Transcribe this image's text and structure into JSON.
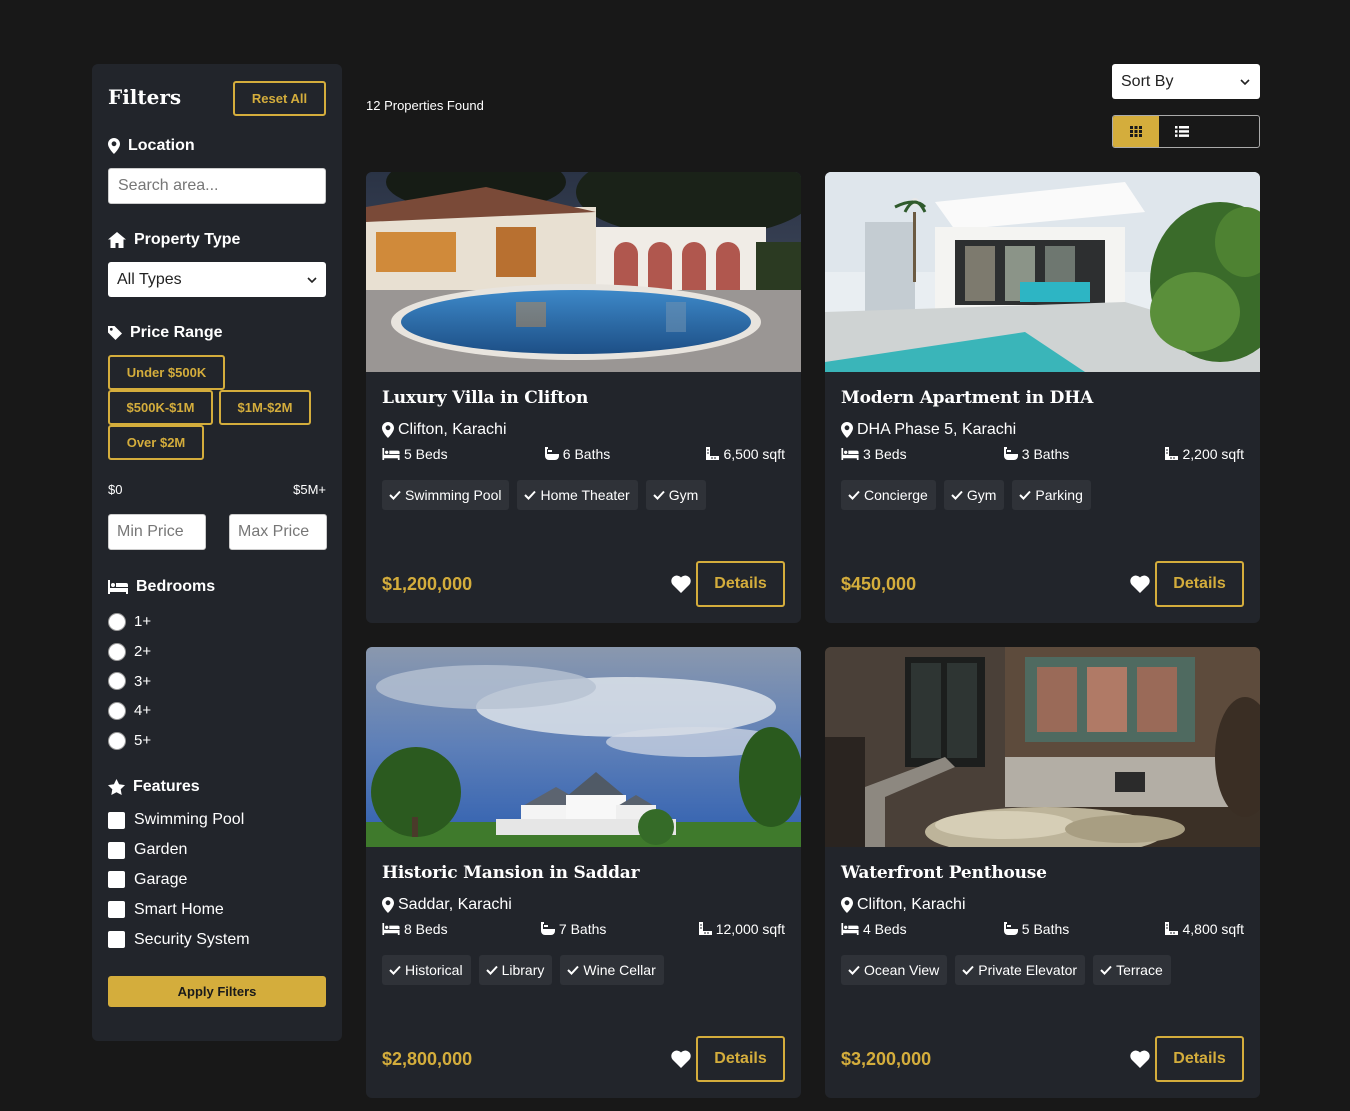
{
  "filters": {
    "title": "Filters",
    "reset_label": "Reset All",
    "location": {
      "label": "Location",
      "placeholder": "Search area..."
    },
    "property_type": {
      "label": "Property Type",
      "selected": "All Types"
    },
    "price_range": {
      "label": "Price Range",
      "chips": [
        "Under $500K",
        "$500K-$1M",
        "$1M-$2M",
        "Over $2M"
      ],
      "min_label": "$0",
      "max_label": "$5M+",
      "min_placeholder": "Min Price",
      "max_placeholder": "Max Price"
    },
    "bedrooms": {
      "label": "Bedrooms",
      "options": [
        "1+",
        "2+",
        "3+",
        "4+",
        "5+"
      ]
    },
    "features": {
      "label": "Features",
      "options": [
        "Swimming Pool",
        "Garden",
        "Garage",
        "Smart Home",
        "Security System"
      ]
    },
    "apply_label": "Apply Filters"
  },
  "results": {
    "count_text": "12 Properties Found"
  },
  "sort": {
    "label": "Sort By"
  },
  "colors": {
    "accent": "#d4ad3c",
    "background": "#181818",
    "card": "#22252b",
    "tag": "#2f3238"
  },
  "properties": [
    {
      "title": "Luxury Villa in Clifton",
      "location": "Clifton, Karachi",
      "beds": "5 Beds",
      "baths": "6 Baths",
      "area": "6,500 sqft",
      "tags": [
        "Swimming Pool",
        "Home Theater",
        "Gym"
      ],
      "price": "$1,200,000",
      "details_label": "Details"
    },
    {
      "title": "Modern Apartment in DHA",
      "location": "DHA Phase 5, Karachi",
      "beds": "3 Beds",
      "baths": "3 Baths",
      "area": "2,200 sqft",
      "tags": [
        "Concierge",
        "Gym",
        "Parking"
      ],
      "price": "$450,000",
      "details_label": "Details"
    },
    {
      "title": "Historic Mansion in Saddar",
      "location": "Saddar, Karachi",
      "beds": "8 Beds",
      "baths": "7 Baths",
      "area": "12,000 sqft",
      "tags": [
        "Historical",
        "Library",
        "Wine Cellar"
      ],
      "price": "$2,800,000",
      "details_label": "Details"
    },
    {
      "title": "Waterfront Penthouse",
      "location": "Clifton, Karachi",
      "beds": "4 Beds",
      "baths": "5 Baths",
      "area": "4,800 sqft",
      "tags": [
        "Ocean View",
        "Private Elevator",
        "Terrace"
      ],
      "price": "$3,200,000",
      "details_label": "Details"
    }
  ]
}
